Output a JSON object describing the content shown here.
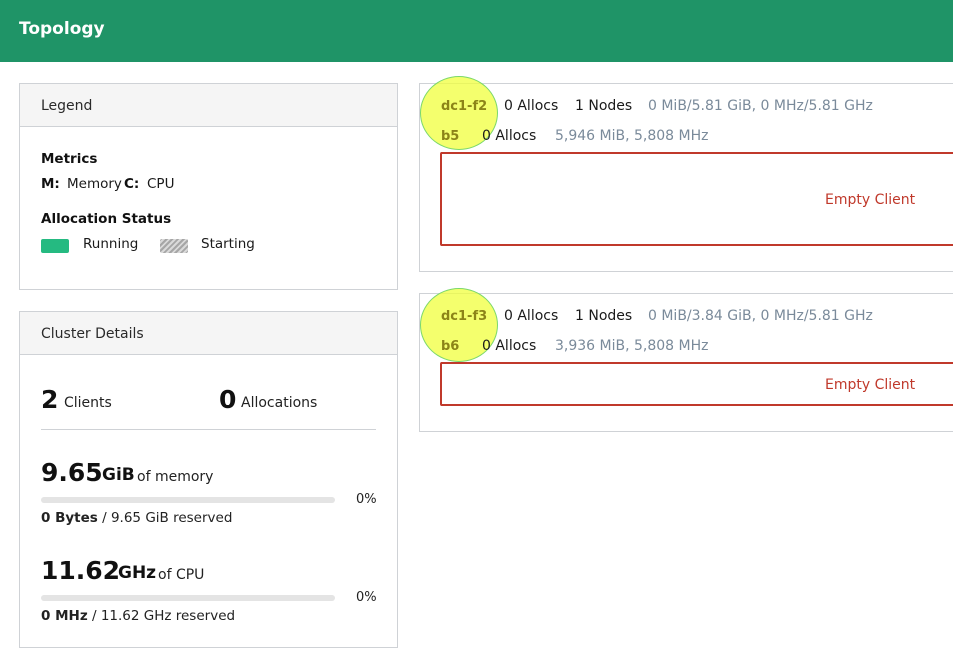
{
  "header": {
    "title": "Topology"
  },
  "legend": {
    "title": "Legend",
    "metrics_heading": "Metrics",
    "memory_key": "M:",
    "memory_label": "Memory",
    "cpu_key": "C:",
    "cpu_label": "CPU",
    "status_heading": "Allocation Status",
    "running_label": "Running",
    "starting_label": "Starting",
    "colors": {
      "running": "#25ba81"
    }
  },
  "cluster": {
    "title": "Cluster Details",
    "clients_count": "2",
    "clients_label": "Clients",
    "allocations_count": "0",
    "allocations_label": "Allocations",
    "memory_value": "9.65",
    "memory_unit": "GiB",
    "memory_suffix": "of memory",
    "memory_pct": "0%",
    "memory_pct_value": 0,
    "memory_reserved_bold": "0 Bytes",
    "memory_reserved_rest": "/ 9.65 GiB reserved",
    "cpu_value": "11.62",
    "cpu_unit": "GHz",
    "cpu_suffix": "of CPU",
    "cpu_pct": "0%",
    "cpu_pct_value": 0,
    "cpu_reserved_bold": "0 MHz",
    "cpu_reserved_rest": "/ 11.62 GHz reserved"
  },
  "datacenters": [
    {
      "name": "dc1-f2",
      "allocs": "0 Allocs",
      "nodes": "1 Nodes",
      "usage": "0 MiB/5.81 GiB, 0 MHz/5.81 GHz",
      "node": {
        "name": "b5",
        "allocs": "0 Allocs",
        "resources": "5,946 MiB, 5,808 MHz",
        "status": "Empty Client"
      }
    },
    {
      "name": "dc1-f3",
      "allocs": "0 Allocs",
      "nodes": "1 Nodes",
      "usage": "0 MiB/3.84 GiB, 0 MHz/5.81 GHz",
      "node": {
        "name": "b6",
        "allocs": "0 Allocs",
        "resources": "3,936 MiB, 5,808 MHz",
        "status": "Empty Client"
      }
    }
  ]
}
